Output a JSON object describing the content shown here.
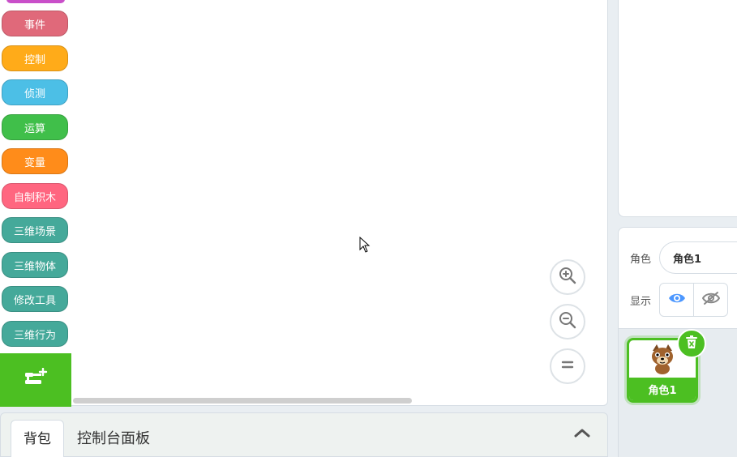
{
  "categories": [
    {
      "label": "",
      "color": "#c94fc9"
    },
    {
      "label": "事件",
      "color": "#e0697a"
    },
    {
      "label": "控制",
      "color": "#ffab19"
    },
    {
      "label": "侦测",
      "color": "#4cbfe6"
    },
    {
      "label": "运算",
      "color": "#40bf4a"
    },
    {
      "label": "变量",
      "color": "#ff8c1a"
    },
    {
      "label": "自制积木",
      "color": "#ff6680"
    },
    {
      "label": "三维场景",
      "color": "#45a99a"
    },
    {
      "label": "三维物体",
      "color": "#45a99a"
    },
    {
      "label": "修改工具",
      "color": "#45a99a"
    },
    {
      "label": "三维行为",
      "color": "#45a99a"
    }
  ],
  "bottom_panel": {
    "backpack_tab": "背包",
    "console_label": "控制台面板"
  },
  "sprite_info": {
    "sprite_label": "角色",
    "sprite_name_value": "角色1",
    "show_label": "显示"
  },
  "sprite_list": {
    "sprites": [
      {
        "name": "角色1"
      }
    ]
  },
  "colors": {
    "accent_green": "#4cbf22",
    "show_eye_blue": "#4c97ff"
  },
  "icons": {
    "extension": "add-extension-icon",
    "zoom_in": "zoom-in-icon",
    "zoom_out": "zoom-out-icon",
    "zoom_reset": "zoom-reset-icon",
    "collapse": "chevron-up-icon",
    "show": "eye-icon",
    "hide": "eye-off-icon",
    "delete": "trash-icon"
  }
}
